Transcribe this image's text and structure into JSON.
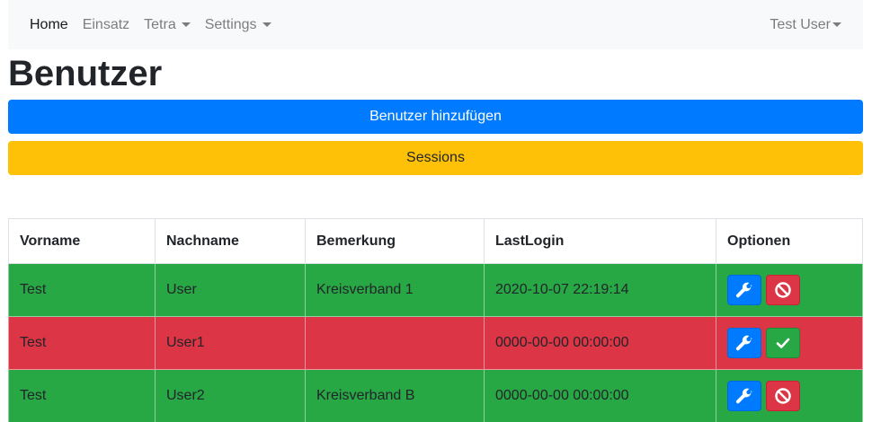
{
  "navbar": {
    "items": [
      {
        "label": "Home"
      },
      {
        "label": "Einsatz"
      },
      {
        "label": "Tetra"
      },
      {
        "label": "Settings"
      }
    ],
    "user": "Test User"
  },
  "page": {
    "title": "Benutzer",
    "add_button": "Benutzer hinzufügen",
    "sessions_button": "Sessions"
  },
  "table": {
    "headers": [
      "Vorname",
      "Nachname",
      "Bemerkung",
      "LastLogin",
      "Optionen"
    ],
    "rows": [
      {
        "vorname": "Test",
        "nachname": "User",
        "bemerkung": "Kreisverband 1",
        "lastlogin": "2020-10-07 22:19:14",
        "status": "active",
        "row_color": "#28a745",
        "actions": [
          "wrench-icon",
          "ban-icon"
        ]
      },
      {
        "vorname": "Test",
        "nachname": "User1",
        "bemerkung": "",
        "lastlogin": "0000-00-00 00:00:00",
        "status": "disabled",
        "row_color": "#dc3545",
        "actions": [
          "wrench-icon",
          "check-icon"
        ]
      },
      {
        "vorname": "Test",
        "nachname": "User2",
        "bemerkung": "Kreisverband B",
        "lastlogin": "0000-00-00 00:00:00",
        "status": "active",
        "row_color": "#28a745",
        "actions": [
          "wrench-icon",
          "ban-icon"
        ]
      }
    ]
  },
  "colors": {
    "primary": "#007bff",
    "warning": "#ffc107",
    "success": "#28a745",
    "danger": "#dc3545"
  }
}
